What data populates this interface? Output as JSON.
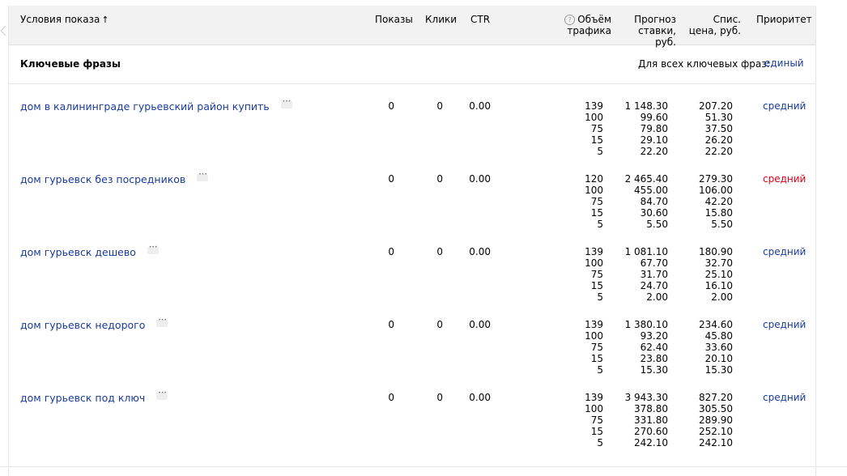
{
  "header": {
    "col_condition": "Условия показа",
    "col_condition_sort": "↑",
    "col_shows": "Показы",
    "col_clicks": "Клики",
    "col_ctr": "CTR",
    "col_volume_1": "Объём",
    "col_volume_2": "трафика",
    "col_forecast_1": "Прогноз",
    "col_forecast_2": "ставки, руб.",
    "col_price_1": "Спис.",
    "col_price_2": "цена, руб.",
    "col_priority": "Приоритет",
    "help_glyph": "?"
  },
  "group": {
    "title": "Ключевые фразы",
    "label": "Для всех ключевых фраз:",
    "value": "единый"
  },
  "rows": [
    {
      "phrase": "дом в калининграде гурьевский район купить",
      "shows": "0",
      "clicks": "0",
      "ctr": "0.00",
      "volume": [
        "139",
        "100",
        "75",
        "15",
        "5"
      ],
      "forecast": [
        "1 148.30",
        "99.60",
        "79.80",
        "29.10",
        "22.20"
      ],
      "price": [
        "207.20",
        "51.30",
        "37.50",
        "26.20",
        "22.20"
      ],
      "priority": "средний",
      "priority_color": "#1a3a9c"
    },
    {
      "phrase": "дом гурьевск без посредников",
      "shows": "0",
      "clicks": "0",
      "ctr": "0.00",
      "volume": [
        "120",
        "100",
        "75",
        "15",
        "5"
      ],
      "forecast": [
        "2 465.40",
        "455.00",
        "84.70",
        "30.60",
        "5.50"
      ],
      "price": [
        "279.30",
        "106.00",
        "42.20",
        "15.80",
        "5.50"
      ],
      "priority": "средний",
      "priority_color": "#e0001a"
    },
    {
      "phrase": "дом гурьевск дешево",
      "shows": "0",
      "clicks": "0",
      "ctr": "0.00",
      "volume": [
        "139",
        "100",
        "75",
        "15",
        "5"
      ],
      "forecast": [
        "1 081.10",
        "67.70",
        "31.70",
        "24.70",
        "2.00"
      ],
      "price": [
        "180.90",
        "32.70",
        "25.10",
        "16.10",
        "2.00"
      ],
      "priority": "средний",
      "priority_color": "#1a3a9c"
    },
    {
      "phrase": "дом гурьевск недорого",
      "shows": "0",
      "clicks": "0",
      "ctr": "0.00",
      "volume": [
        "139",
        "100",
        "75",
        "15",
        "5"
      ],
      "forecast": [
        "1 380.10",
        "93.20",
        "62.40",
        "23.80",
        "15.30"
      ],
      "price": [
        "234.60",
        "45.80",
        "33.60",
        "20.10",
        "15.30"
      ],
      "priority": "средний",
      "priority_color": "#1a3a9c"
    },
    {
      "phrase": "дом гурьевск под ключ",
      "shows": "0",
      "clicks": "0",
      "ctr": "0.00",
      "volume": [
        "139",
        "100",
        "75",
        "15",
        "5"
      ],
      "forecast": [
        "3 943.30",
        "378.80",
        "331.80",
        "270.60",
        "242.10"
      ],
      "price": [
        "827.20",
        "305.50",
        "289.90",
        "252.10",
        "242.10"
      ],
      "priority": "средний",
      "priority_color": "#1a3a9c"
    }
  ]
}
